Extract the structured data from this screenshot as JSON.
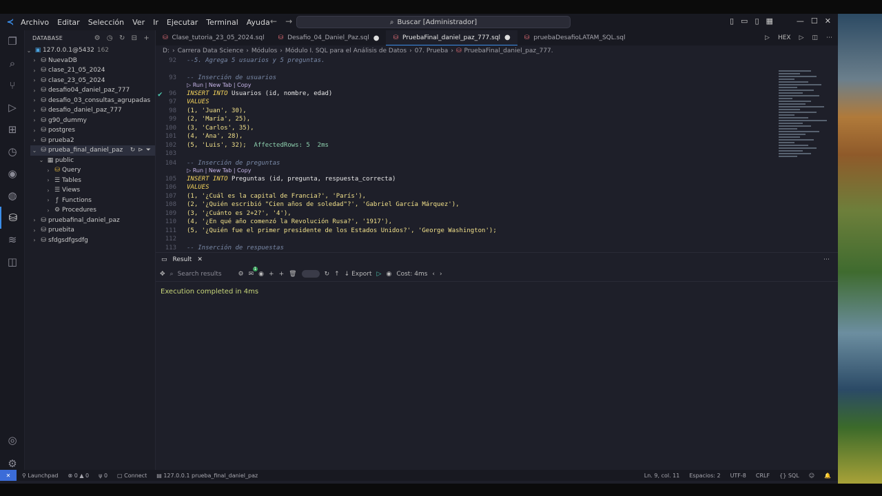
{
  "menu": [
    "Archivo",
    "Editar",
    "Selección",
    "Ver",
    "Ir",
    "Ejecutar",
    "Terminal",
    "Ayuda"
  ],
  "command_center": "Buscar [Administrador]",
  "sidebar": {
    "title": "DATABASE",
    "connection": {
      "label": "127.0.0.1@5432",
      "count": "162"
    },
    "items": [
      "NuevaDB",
      "clase_21_05_2024",
      "clase_23_05_2024",
      "desafio04_daniel_paz_777",
      "desafio_03_consultas_agrupadas",
      "desafio_daniel_paz_777",
      "g90_dummy",
      "postgres",
      "prueba2",
      "prueba_final_daniel_paz"
    ],
    "schema": "public",
    "schema_children": [
      "Query",
      "Tables",
      "Views",
      "Functions",
      "Procedures"
    ],
    "items_after": [
      "pruebafinal_daniel_paz",
      "pruebita",
      "sfdgsdfgsdfg"
    ]
  },
  "tabs": [
    {
      "label": "Clase_tutoria_23_05_2024.sql",
      "dirty": false
    },
    {
      "label": "Desafio_04_Daniel_Paz.sql",
      "dirty": true
    },
    {
      "label": "PruebaFinal_daniel_paz_777.sql",
      "dirty": true
    },
    {
      "label": "pruebaDesafioLATAM_SQL.sql",
      "dirty": false
    }
  ],
  "tab_actions": {
    "hex": "HEX"
  },
  "breadcrumb": [
    "D:",
    "Carrera Data Science",
    "Módulos",
    "Módulo I. SQL para el Análisis de Datos",
    "07. Prueba",
    "PruebaFinal_daniel_paz_777."
  ],
  "editor": {
    "codelens": "Run | New Tab | Copy",
    "line_numbers": [
      "92",
      "93",
      "96",
      "97",
      "98",
      "99",
      "100",
      "101",
      "102",
      "103",
      "104",
      "105",
      "106",
      "107",
      "108",
      "109",
      "110",
      "111",
      "112",
      "113"
    ],
    "lines": {
      "l92": "--5. Agrega 5 usuarios y 5 preguntas.",
      "l93": "-- Inserción de usuarios",
      "l96a": "INSERT INTO",
      "l96b": " Usuarios (id, nombre, edad)",
      "l97": "VALUES",
      "l98": "(1, 'Juan', 30),",
      "l99": "(2, 'María', 25),",
      "l100": "(3, 'Carlos', 35),",
      "l101": "(4, 'Ana', 28),",
      "l102": "(5, 'Luis', 32);",
      "affected": "AffectedRows: 5  2ms",
      "l104": "-- Inserción de preguntas",
      "l105a": "INSERT INTO",
      "l105b": " Preguntas (id, pregunta, respuesta_correcta)",
      "l106": "VALUES",
      "l107": "(1, '¿Cuál es la capital de Francia?', 'París'),",
      "l108": "(2, '¿Quién escribió \"Cien años de soledad\"?', 'Gabriel García Márquez'),",
      "l109": "(3, '¿Cuánto es 2+2?', '4'),",
      "l110": "(4, '¿En qué año comenzó la Revolución Rusa?', '1917'),",
      "l111": "(5, '¿Quién fue el primer presidente de los Estados Unidos?', 'George Washington');",
      "l113": "-- Inserción de respuestas"
    }
  },
  "panel": {
    "tab": "Result",
    "search_placeholder": "Search results",
    "export": "Export",
    "cost": "Cost: 4ms",
    "badge": "1",
    "message": "Execution completed in 4ms"
  },
  "statusbar": {
    "launchpad": "Launchpad",
    "problems": "0 ▲ 0",
    "ports": "0",
    "connect": "Connect",
    "db": "127.0.0.1  prueba_final_daniel_paz",
    "position": "Ln. 9, col. 11",
    "spaces": "Espacios: 2",
    "encoding": "UTF-8",
    "eol": "CRLF",
    "lang": "SQL"
  },
  "colors": {
    "accent": "#3b8eea",
    "success": "#4ec9b0",
    "exec_text": "#c9d77a"
  }
}
